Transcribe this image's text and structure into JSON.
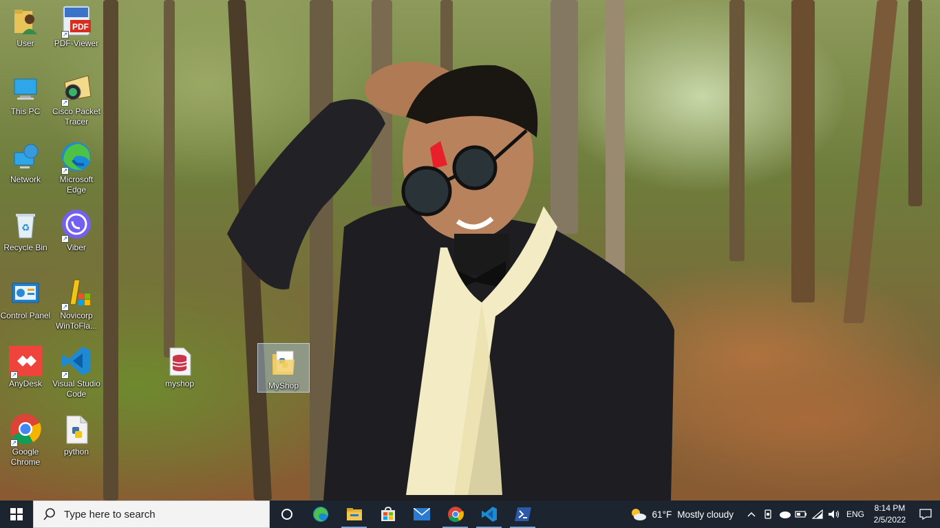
{
  "desktop": {
    "icons": [
      {
        "label": "User"
      },
      {
        "label": "PDF-Viewer"
      },
      {
        "label": "This PC"
      },
      {
        "label": "Cisco Packet Tracer"
      },
      {
        "label": "Network"
      },
      {
        "label": "Microsoft Edge"
      },
      {
        "label": "Recycle Bin"
      },
      {
        "label": "Viber"
      },
      {
        "label": "Control Panel"
      },
      {
        "label": "Novicorp WinToFla..."
      },
      {
        "label": "AnyDesk"
      },
      {
        "label": "Visual Studio Code"
      },
      {
        "label": "myshop"
      },
      {
        "label": "MyShop"
      },
      {
        "label": "Google Chrome"
      },
      {
        "label": "python"
      }
    ],
    "pdf_badge": "PDF"
  },
  "taskbar": {
    "search_placeholder": "Type here to search",
    "weather": {
      "temp": "61°F",
      "condition": "Mostly cloudy"
    },
    "language": "ENG",
    "time": "8:14 PM",
    "date": "2/5/2022"
  },
  "colors": {
    "taskbar_bg": "#1c2430",
    "accent": "#0078d7"
  }
}
